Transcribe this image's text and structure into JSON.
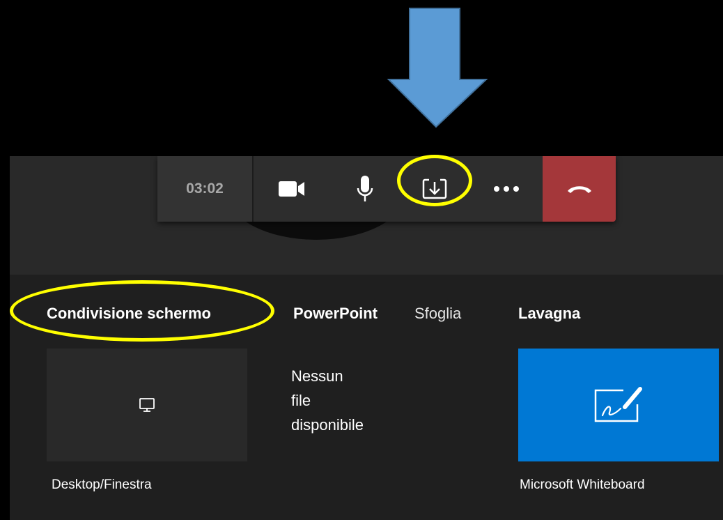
{
  "toolbar": {
    "timer": "03:02",
    "buttons": [
      {
        "name": "camera",
        "icon": "video-camera-icon"
      },
      {
        "name": "microphone",
        "icon": "microphone-icon"
      },
      {
        "name": "share",
        "icon": "share-tray-icon"
      },
      {
        "name": "more",
        "icon": "more-ellipsis-icon"
      },
      {
        "name": "hangup",
        "icon": "phone-hangup-icon"
      }
    ]
  },
  "share_panel": {
    "tabs": {
      "screen_share": "Condivisione schermo",
      "powerpoint": "PowerPoint",
      "browse": "Sfoglia",
      "whiteboard": "Lavagna"
    },
    "desktop_tile": {
      "caption": "Desktop/Finestra",
      "icon": "monitor-icon"
    },
    "powerpoint_empty": {
      "line1": "Nessun",
      "line2": "file",
      "line3": "disponibile"
    },
    "whiteboard_tile": {
      "caption": "Microsoft Whiteboard",
      "icon": "whiteboard-pen-icon"
    }
  },
  "annotations": {
    "arrow_color": "#5b9bd5",
    "highlight_color": "#ffff00"
  },
  "colors": {
    "hangup": "#a4373a",
    "whiteboard_tile": "#0078d4",
    "panel_bg": "#1f1f1f"
  }
}
